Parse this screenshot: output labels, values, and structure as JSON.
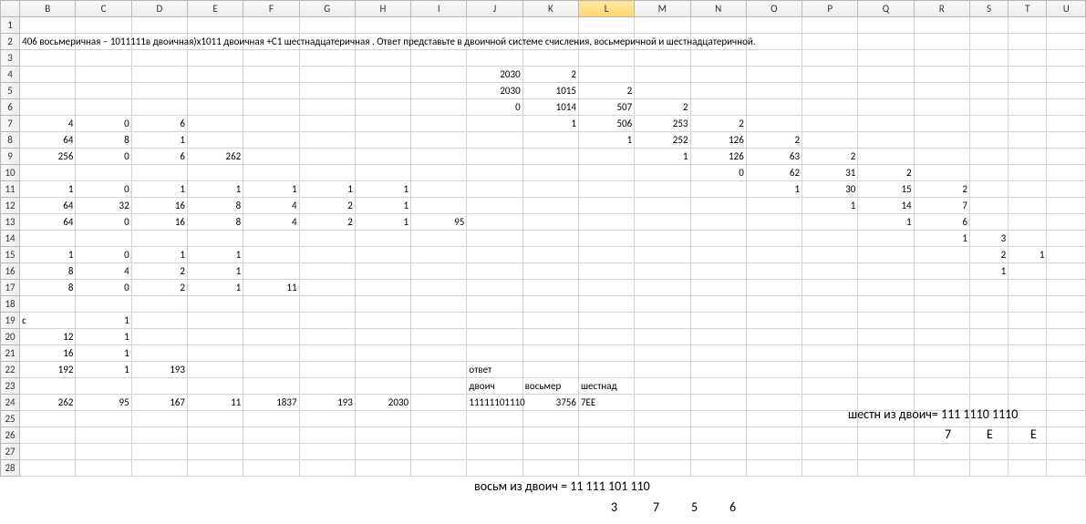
{
  "columns": [
    "B",
    "C",
    "D",
    "E",
    "F",
    "G",
    "H",
    "I",
    "J",
    "K",
    "L",
    "M",
    "N",
    "O",
    "P",
    "Q",
    "R",
    "S",
    "T",
    "U"
  ],
  "active_column": "L",
  "row_start": 1,
  "row_end": 28,
  "long_text": "406 восьмеричная – 1011111в двоичная)х1011 двоичная +С1 шестнадцатеричная . Ответ представьте в двоичной системе счисления, восьмеричной и шестнадцатеричной.",
  "cells": {
    "4": {
      "J": "2030",
      "K": "2"
    },
    "5": {
      "J": "2030",
      "K": "1015",
      "L": "2"
    },
    "6": {
      "J": "0",
      "K": "1014",
      "L": "507",
      "M": "2"
    },
    "7": {
      "B": "4",
      "C": "0",
      "D": "6",
      "K": "1",
      "L": "506",
      "M": "253",
      "N": "2"
    },
    "8": {
      "B": "64",
      "C": "8",
      "D": "1",
      "L": "1",
      "M": "252",
      "N": "126",
      "O": "2"
    },
    "9": {
      "B": "256",
      "C": "0",
      "D": "6",
      "E": "262",
      "M": "1",
      "N": "126",
      "O": "63",
      "P": "2"
    },
    "10": {
      "N": "0",
      "O": "62",
      "P": "31",
      "Q": "2"
    },
    "11": {
      "B": "1",
      "C": "0",
      "D": "1",
      "E": "1",
      "F": "1",
      "G": "1",
      "H": "1",
      "O": "1",
      "P": "30",
      "Q": "15",
      "R": "2"
    },
    "12": {
      "B": "64",
      "C": "32",
      "D": "16",
      "E": "8",
      "F": "4",
      "G": "2",
      "H": "1",
      "P": "1",
      "Q": "14",
      "R": "7"
    },
    "13": {
      "B": "64",
      "C": "0",
      "D": "16",
      "E": "8",
      "F": "4",
      "G": "2",
      "H": "1",
      "I": "95",
      "Q": "1",
      "R": "6"
    },
    "14": {
      "R": "1",
      "S": "3"
    },
    "15": {
      "B": "1",
      "C": "0",
      "D": "1",
      "E": "1",
      "S": "2",
      "T": "1"
    },
    "16": {
      "B": "8",
      "C": "4",
      "D": "2",
      "E": "1",
      "S": "1"
    },
    "17": {
      "B": "8",
      "C": "0",
      "D": "2",
      "E": "1",
      "F": "11"
    },
    "19": {
      "B_txt": "c",
      "C": "1"
    },
    "20": {
      "B": "12",
      "C": "1"
    },
    "21": {
      "B": "16",
      "C": "1"
    },
    "22": {
      "B": "192",
      "C": "1",
      "D": "193",
      "J_txt": "ответ"
    },
    "23": {
      "J_txt": "двоич",
      "K_txt": "восьмер",
      "L_txt": "шестнад"
    },
    "24": {
      "B": "262",
      "C": "95",
      "D": "167",
      "E": "11",
      "F": "1837",
      "G": "193",
      "H": "2030",
      "J": "11111101110",
      "K": "3756",
      "L_txt": "7EE"
    }
  },
  "overlays": {
    "o1": "шестн из двоич= 111 1110 1110",
    "o2_a": "7",
    "o2_b": "E",
    "o2_c": "E",
    "o3": "восьм из двоич = 11 111 101 110",
    "o4_a": "3",
    "o4_b": "7",
    "o4_c": "5",
    "o4_d": "6"
  },
  "col_widths": {
    "rowhead": 20,
    "default": 58,
    "S": 40,
    "T": 40,
    "U": 40
  }
}
